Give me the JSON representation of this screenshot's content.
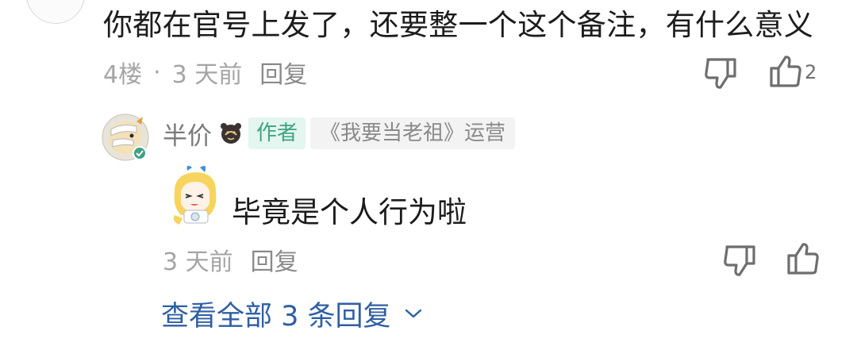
{
  "comment": {
    "text": "你都在官号上发了，还要整一个这个备注，有什么意义",
    "floor": "4楼",
    "separator": "·",
    "time": "3 天前",
    "reply_label": "回复",
    "like_count": "2"
  },
  "author_reply": {
    "author_name": "半价",
    "author_tag": "作者",
    "role_tag": "《我要当老祖》运营",
    "text": "毕竟是个人行为啦",
    "time": "3 天前",
    "reply_label": "回复"
  },
  "view_all": {
    "label": "查看全部 3 条回复"
  },
  "colors": {
    "link": "#2f5fa3",
    "tag_author_bg": "#e3f6ef",
    "tag_author_text": "#3fa282",
    "meta": "#a5a5a5"
  }
}
